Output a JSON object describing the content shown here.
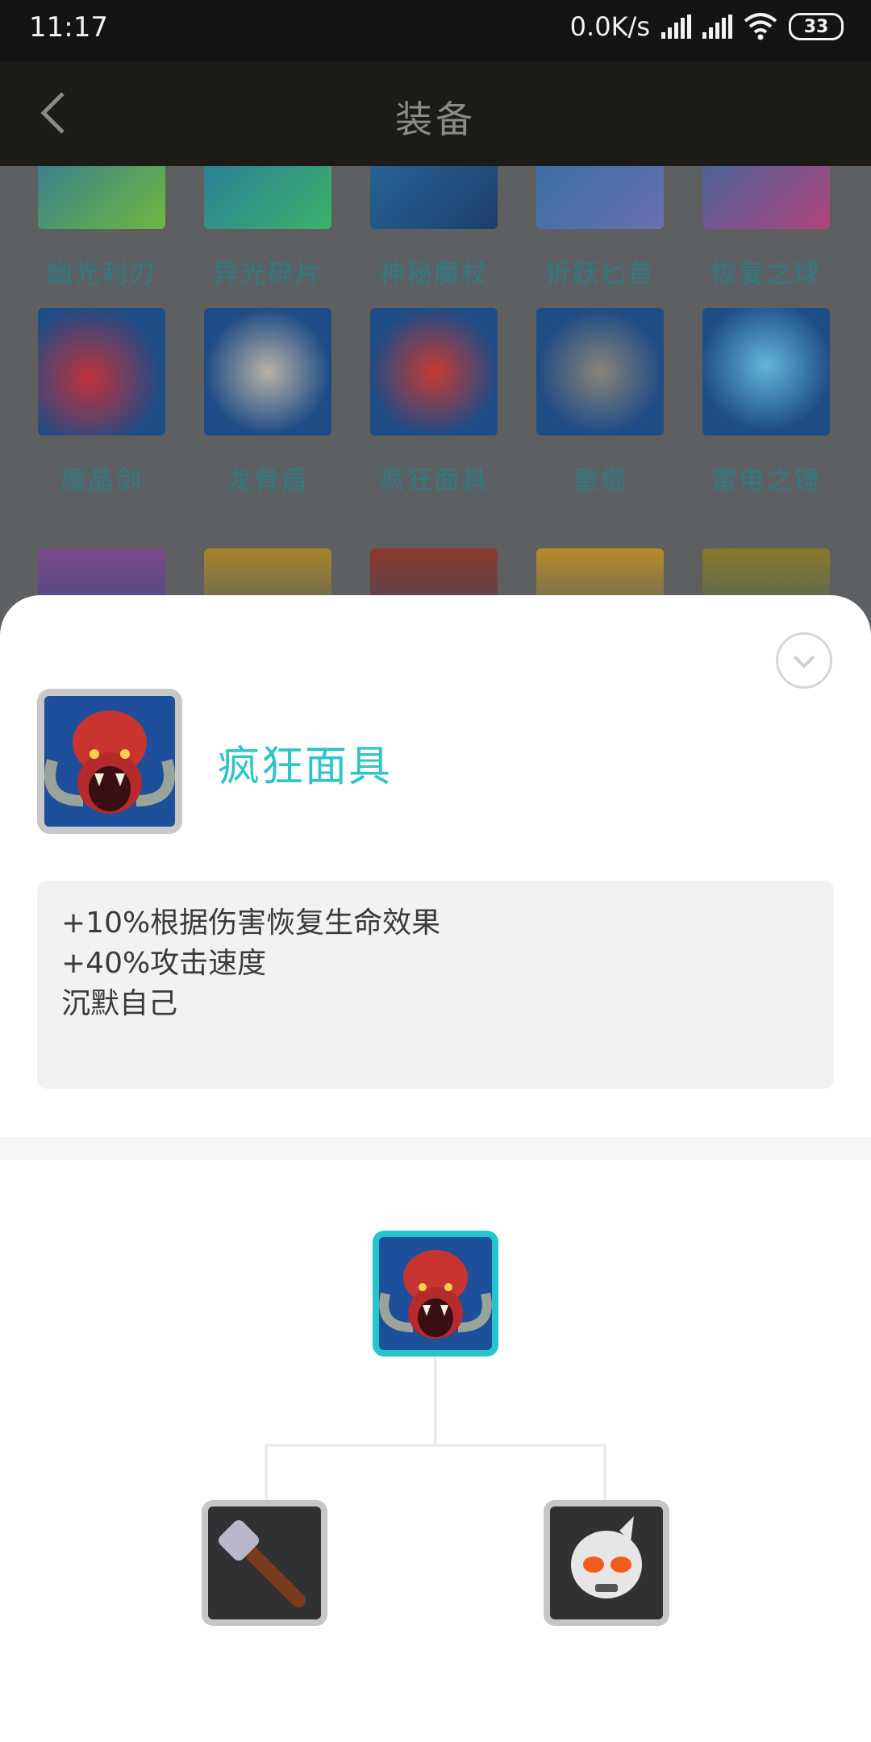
{
  "status_bar": {
    "time": "11:17",
    "network_speed": "0.0K/s",
    "battery": "33"
  },
  "header": {
    "title": "装备"
  },
  "grid": {
    "rows": [
      [
        "幽光利刃",
        "异光碎片",
        "神秘魔杖",
        "折跃匕首",
        "恢复之球"
      ],
      [
        "魔晶剑",
        "龙骨盾",
        "疯狂面具",
        "重棍",
        "雷电之锤"
      ]
    ]
  },
  "detail": {
    "name": "疯狂面具",
    "description": [
      "+10%根据伤害恢复生命效果",
      "+40%攻击速度",
      "沉默自己"
    ]
  },
  "colors": {
    "accent": "#2ec4c8",
    "header_bg": "#1c1b18",
    "dim_overlay": "#5e6163"
  },
  "icons": {
    "back": "back-chevron-icon",
    "collapse": "chevron-down-circle-icon"
  }
}
